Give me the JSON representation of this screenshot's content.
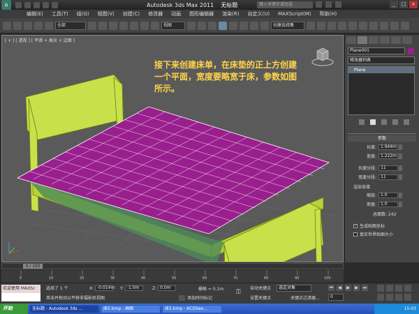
{
  "window": {
    "app_title": "Autodesk 3ds Max  2011",
    "doc_title": "无标题",
    "search_placeholder": "键入关键字或短语"
  },
  "menu": [
    "编辑(E)",
    "工具(T)",
    "组(G)",
    "视图(V)",
    "创建(C)",
    "修改器",
    "动画",
    "图形编辑器",
    "渲染(R)",
    "自定义(U)",
    "MAXScript(M)",
    "帮助(H)"
  ],
  "toolbar": {
    "filter_value": "全部",
    "view_value": "视图",
    "selection_set_value": "创建选择集"
  },
  "viewport": {
    "label": "[ + ] [ 透视 ] [ 平滑 + 高光 + 边面 ]",
    "annotation": "接下来创建床单，在床垫的正上方创建一个平面，宽度要略宽于床，参数如图所示。",
    "plane_color": "#9a1f8e",
    "frame_color": "#c8e04a"
  },
  "command_panel": {
    "object_name": "Plane001",
    "object_color": "#9a1f8e",
    "modifier_list": "修改器列表",
    "stack_item": "Plane",
    "rollout_title": "参数",
    "length_label": "长度:",
    "length_value": "1.944m",
    "width_label": "宽度:",
    "width_value": "1.222m",
    "length_segs_label": "长度分段:",
    "length_segs_value": "11",
    "width_segs_label": "宽度分段:",
    "width_segs_value": "11",
    "render_mult_label": "渲染倍增",
    "scale_label": "缩放:",
    "scale_value": "1.0",
    "density_label": "密度:",
    "density_value": "1.0",
    "total_faces_label": "总面数: 242",
    "gen_map_label": "生成贴图坐标",
    "real_world_label": "真实世界贴图大小",
    "gen_map_checked": true,
    "real_world_checked": false
  },
  "timeline": {
    "slider_label": "0 / 100",
    "ticks": [
      "0",
      "10",
      "20",
      "30",
      "40",
      "50",
      "60",
      "70",
      "80",
      "90",
      "100"
    ]
  },
  "status": {
    "maxscript_1": "欢迎使用 MAXSc",
    "maxscript_2": "",
    "selected": "选择了 1 个",
    "hint": "单击并拖动以平移非摄影机视图",
    "x_label": "X:",
    "x_value": "-0.014m",
    "y_label": "Y:",
    "y_value": "-1.0m",
    "z_label": "Z:",
    "z_value": "0.0m",
    "grid_label": "栅格 = 0.1m",
    "add_time_tag": "添加时间标记",
    "auto_key": "自动关键点",
    "set_key": "设置关键点",
    "selection_dropdown": "选定对象",
    "key_filters": "关键点过滤器...",
    "frame_value": "0"
  },
  "taskbar": {
    "start": "开始",
    "tasks": [
      "无标题 - Autodesk 3ds ...",
      "床5.bmp - 画图",
      "床5.bmp - ACDSee..."
    ],
    "time": "15:03"
  }
}
